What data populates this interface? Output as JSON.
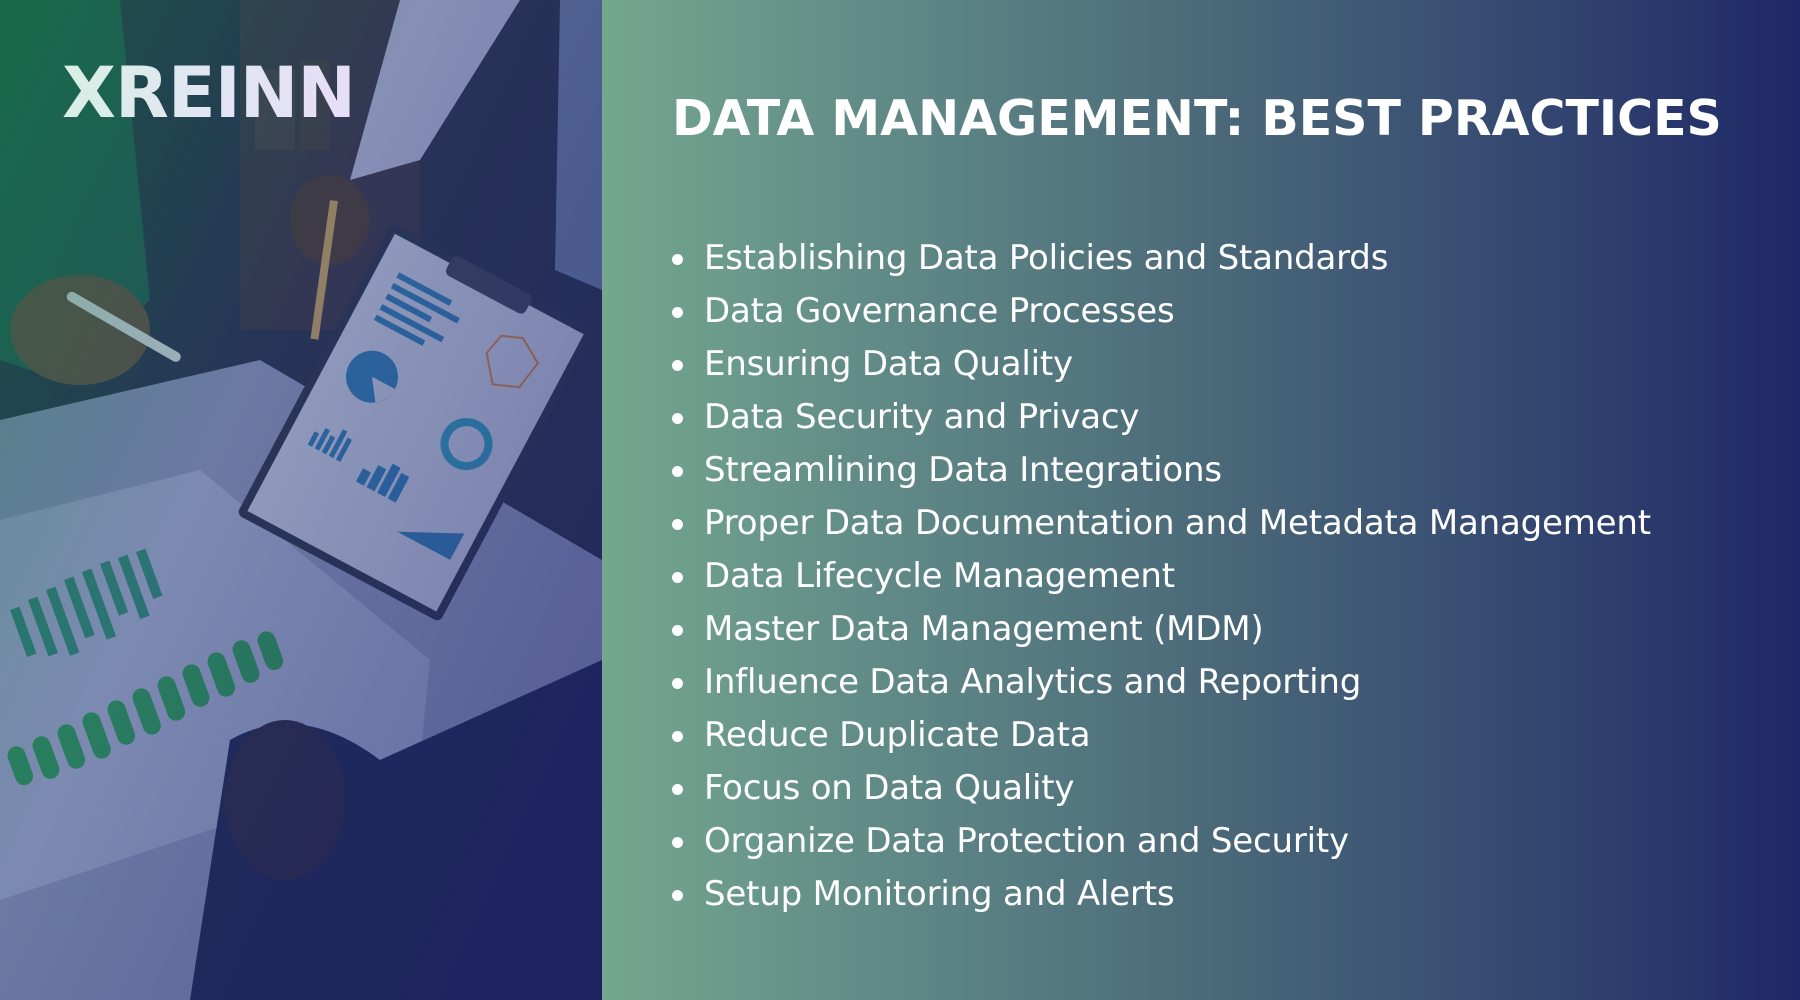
{
  "brand": {
    "logo_text": "XREINN"
  },
  "photo": {
    "description": "business-meeting-charts-photo",
    "tint_colors": [
      "#148a46",
      "#1e236e"
    ]
  },
  "slide": {
    "title": "DATA MANAGEMENT: BEST PRACTICES",
    "background_gradient": [
      "#74a78e",
      "#1f2866"
    ],
    "practices": [
      "Establishing Data Policies and Standards",
      "Data Governance Processes",
      "Ensuring Data Quality",
      "Data Security and Privacy",
      "Streamlining Data Integrations",
      "Proper Data Documentation and Metadata Management",
      "Data Lifecycle Management",
      "Master Data Management (MDM)",
      "Influence Data Analytics and Reporting",
      "Reduce Duplicate Data",
      "Focus on Data Quality",
      "Organize Data Protection and Security",
      "Setup Monitoring and Alerts"
    ]
  }
}
